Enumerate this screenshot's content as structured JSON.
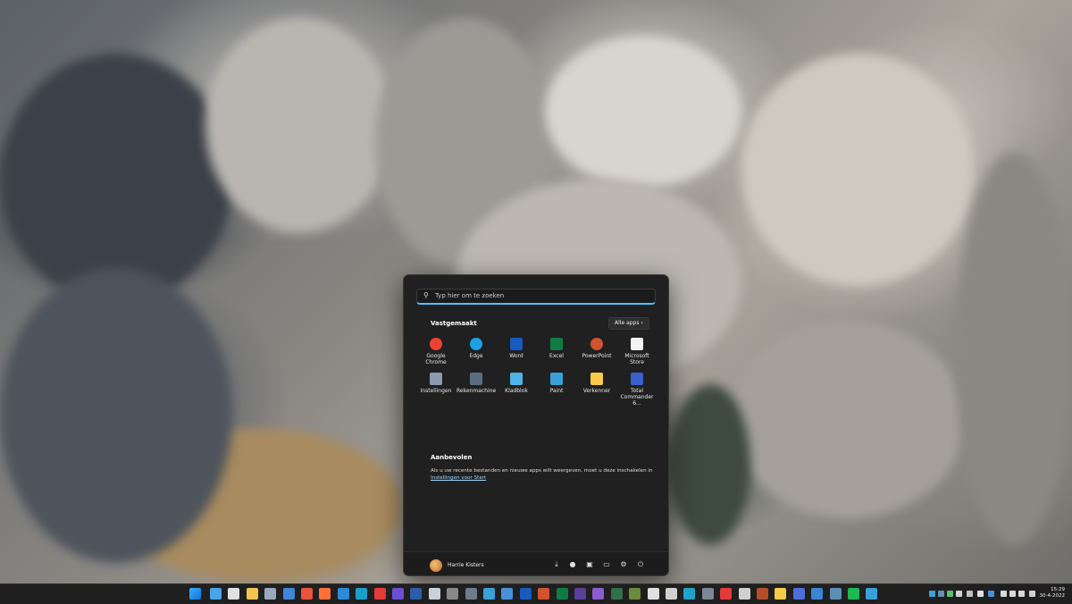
{
  "search": {
    "placeholder": "Typ hier om te zoeken"
  },
  "pinned": {
    "title": "Vastgemaakt",
    "all_apps": "Alle apps",
    "apps": [
      {
        "label": "Google Chrome",
        "icon": "chrome-icon",
        "color": "#ea4335"
      },
      {
        "label": "Edge",
        "icon": "edge-icon",
        "color": "#1ba1e2"
      },
      {
        "label": "Word",
        "icon": "word-icon",
        "color": "#185abd"
      },
      {
        "label": "Excel",
        "icon": "excel-icon",
        "color": "#107c41"
      },
      {
        "label": "PowerPoint",
        "icon": "powerpoint-icon",
        "color": "#d35230"
      },
      {
        "label": "Microsoft Store",
        "icon": "store-icon",
        "color": "#f2f2f2"
      },
      {
        "label": "Instellingen",
        "icon": "settings-icon",
        "color": "#8a9bb0"
      },
      {
        "label": "Rekenmachine",
        "icon": "calculator-icon",
        "color": "#5a6d82"
      },
      {
        "label": "Kladblok",
        "icon": "notepad-icon",
        "color": "#4fb3e8"
      },
      {
        "label": "Paint",
        "icon": "paint-icon",
        "color": "#3aa1d8"
      },
      {
        "label": "Verkenner",
        "icon": "folder-icon",
        "color": "#f8c94a"
      },
      {
        "label": "Total\nCommander 6...",
        "icon": "total-commander-icon",
        "color": "#3b5fcc"
      }
    ]
  },
  "recommended": {
    "title": "Aanbevolen",
    "text": "Als u uw recente bestanden en nieuwe apps wilt weergeven, moet u deze inschakelen in",
    "link": "Instellingen voor Start"
  },
  "user": {
    "name": "Harrie Kisters"
  },
  "footer_icons": [
    "download-icon",
    "palette-icon",
    "picture-folder-icon",
    "folder-icon",
    "gear-icon",
    "power-icon"
  ],
  "taskbar": {
    "time": "15:29",
    "date": "30-4-2022",
    "icon_colors": [
      "#4aa3e8",
      "#e0e0e0",
      "#f1c44e",
      "#9aa8bb",
      "#3e86d9",
      "#e8553a",
      "#ff7139",
      "#2b8bd6",
      "#18a0c9",
      "#e53935",
      "#6a4fd3",
      "#2b5ea8",
      "#c8d1da",
      "#888888",
      "#6d7b8c",
      "#3aa1d8",
      "#4a90d9",
      "#185abd",
      "#d35230",
      "#107c41",
      "#5a3f9b",
      "#8a5cd0",
      "#2f6f4a",
      "#6b8c3a",
      "#e0e0e0",
      "#d0d0d0",
      "#1fa3c9",
      "#7a8798",
      "#e33b3b",
      "#cfcfcf",
      "#b64c2a",
      "#f8c94a",
      "#4c6fd9",
      "#3b86d2",
      "#5d8fb5",
      "#1db954",
      "#39a0d8"
    ]
  }
}
